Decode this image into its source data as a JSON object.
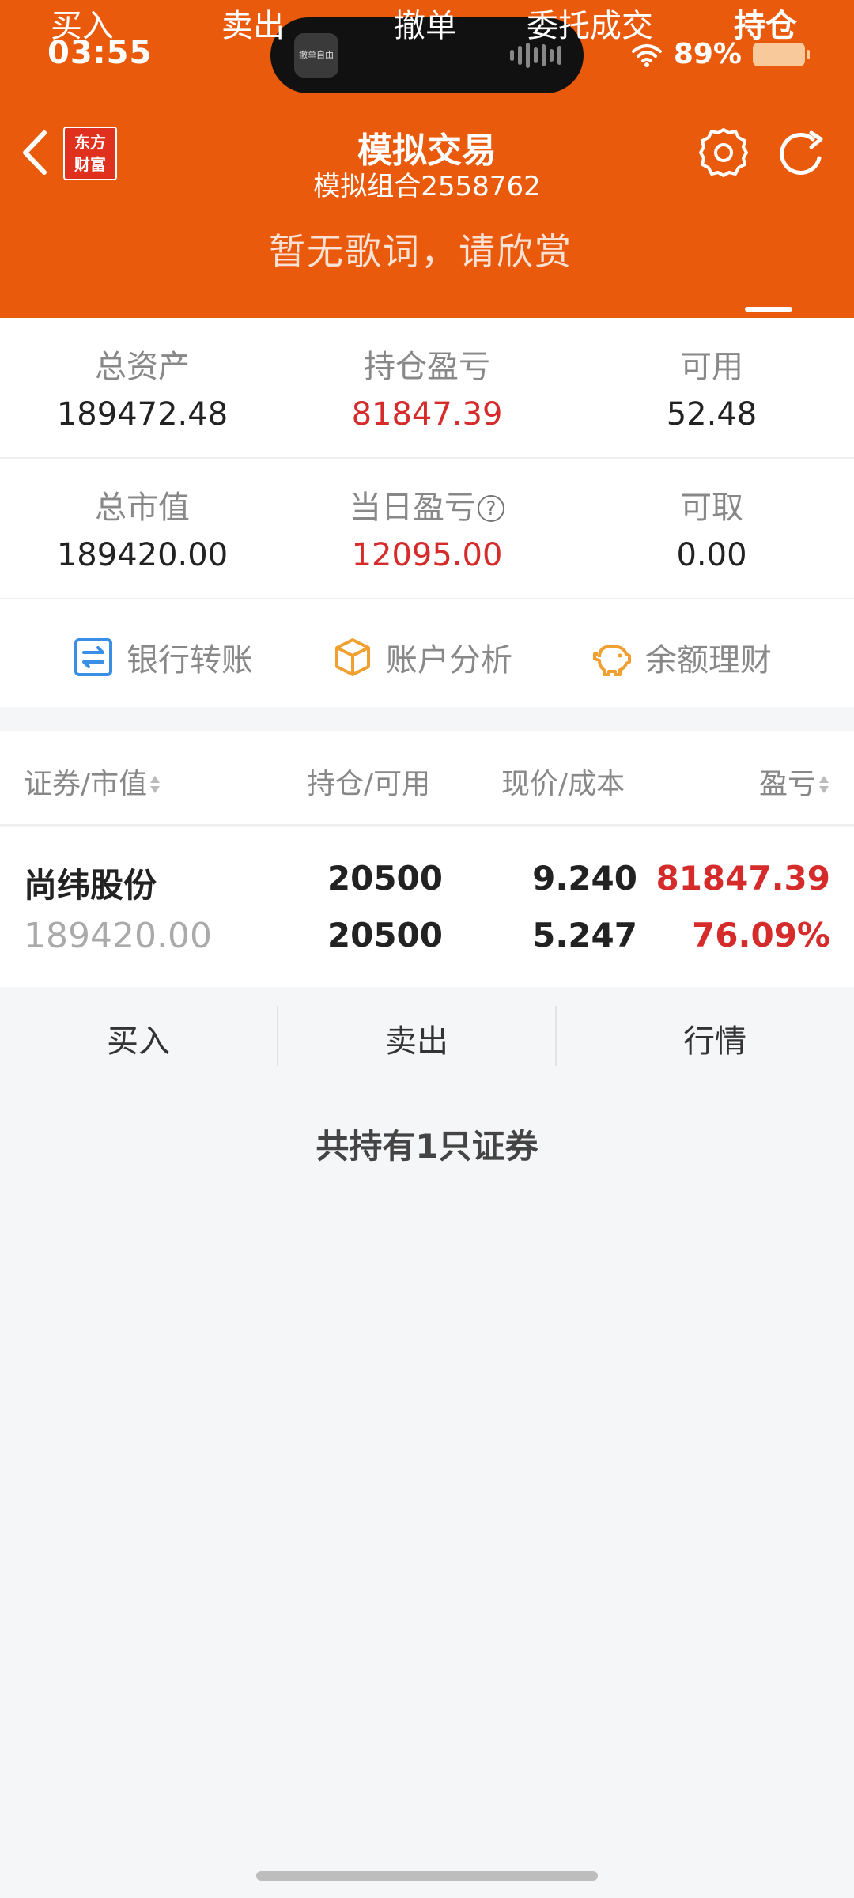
{
  "status_bar": {
    "time": "03:55",
    "battery_pct": "89%",
    "battery_level": 0.89
  },
  "island": {
    "thumb_text": "撤单自由"
  },
  "header": {
    "brand": "东方\n财富",
    "title": "模拟交易",
    "subtitle": "模拟组合2558762",
    "lyric_overlay": "暂无歌词，请欣赏"
  },
  "tabs": [
    {
      "label": "买入"
    },
    {
      "label": "卖出"
    },
    {
      "label": "撤单"
    },
    {
      "label": "委托成交"
    },
    {
      "label": "持仓",
      "active": true
    }
  ],
  "summary": {
    "total_assets": {
      "label": "总资产",
      "value": "189472.48"
    },
    "position_pnl": {
      "label": "持仓盈亏",
      "value": "81847.39"
    },
    "available": {
      "label": "可用",
      "value": "52.48"
    },
    "total_market_value": {
      "label": "总市值",
      "value": "189420.00"
    },
    "daily_pnl": {
      "label": "当日盈亏",
      "value": "12095.00"
    },
    "withdrawable": {
      "label": "可取",
      "value": "0.00"
    }
  },
  "quick_actions": [
    {
      "label": "银行转账",
      "icon": "transfer-icon",
      "color": "#3a8ee6"
    },
    {
      "label": "账户分析",
      "icon": "box-icon",
      "color": "#f0a030"
    },
    {
      "label": "余额理财",
      "icon": "piggy-bank-icon",
      "color": "#f0a030"
    }
  ],
  "holdings": {
    "columns": [
      "证券/市值",
      "持仓/可用",
      "现价/成本",
      "盈亏"
    ],
    "rows": [
      {
        "name": "尚纬股份",
        "market_value": "189420.00",
        "position": "20500",
        "available": "20500",
        "price": "9.240",
        "cost": "5.247",
        "pnl": "81847.39",
        "pnl_pct": "76.09%"
      }
    ]
  },
  "row_actions": [
    "买入",
    "卖出",
    "行情"
  ],
  "footer_text": "共持有1只证券",
  "colors": {
    "brand_orange": "#ea5a0c",
    "gain_red": "#d52b2b"
  }
}
